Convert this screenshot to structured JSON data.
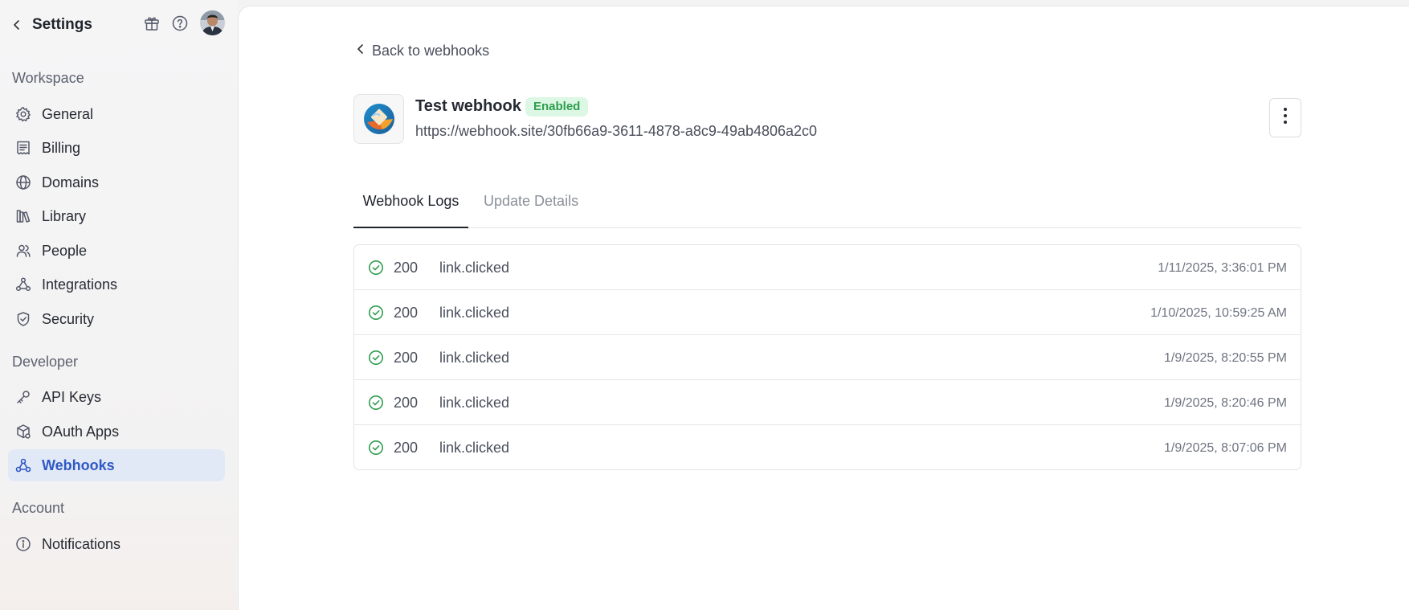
{
  "sidebar": {
    "title": "Settings",
    "header_icons": [
      "chevron-left-icon",
      "gift-icon",
      "help-circle-icon",
      "avatar"
    ],
    "sections": [
      {
        "label": "Workspace",
        "items": [
          {
            "label": "General",
            "icon": "gear-icon"
          },
          {
            "label": "Billing",
            "icon": "receipt-icon"
          },
          {
            "label": "Domains",
            "icon": "globe-icon"
          },
          {
            "label": "Library",
            "icon": "library-icon"
          },
          {
            "label": "People",
            "icon": "people-icon"
          },
          {
            "label": "Integrations",
            "icon": "integrations-icon"
          },
          {
            "label": "Security",
            "icon": "shield-icon"
          }
        ]
      },
      {
        "label": "Developer",
        "items": [
          {
            "label": "API Keys",
            "icon": "key-icon"
          },
          {
            "label": "OAuth Apps",
            "icon": "cube-icon"
          },
          {
            "label": "Webhooks",
            "icon": "webhook-icon",
            "active": true
          }
        ]
      },
      {
        "label": "Account",
        "items": [
          {
            "label": "Notifications",
            "icon": "info-circle-icon"
          }
        ]
      }
    ]
  },
  "main": {
    "back_label": "Back to webhooks",
    "webhook": {
      "name": "Test webhook",
      "status": "Enabled",
      "url": "https://webhook.site/30fb66a9-3611-4878-a8c9-49ab4806a2c0"
    },
    "tabs": [
      {
        "label": "Webhook Logs",
        "active": true
      },
      {
        "label": "Update Details",
        "active": false
      }
    ],
    "logs": [
      {
        "code": "200",
        "event": "link.clicked",
        "time": "1/11/2025, 3:36:01 PM"
      },
      {
        "code": "200",
        "event": "link.clicked",
        "time": "1/10/2025, 10:59:25 AM"
      },
      {
        "code": "200",
        "event": "link.clicked",
        "time": "1/9/2025, 8:20:55 PM"
      },
      {
        "code": "200",
        "event": "link.clicked",
        "time": "1/9/2025, 8:20:46 PM"
      },
      {
        "code": "200",
        "event": "link.clicked",
        "time": "1/9/2025, 8:07:06 PM"
      }
    ]
  },
  "colors": {
    "accent": "#2f59c5",
    "active_bg": "#e2e9f6",
    "success": "#2f9e4f",
    "success_bg": "#dcf7e3"
  }
}
